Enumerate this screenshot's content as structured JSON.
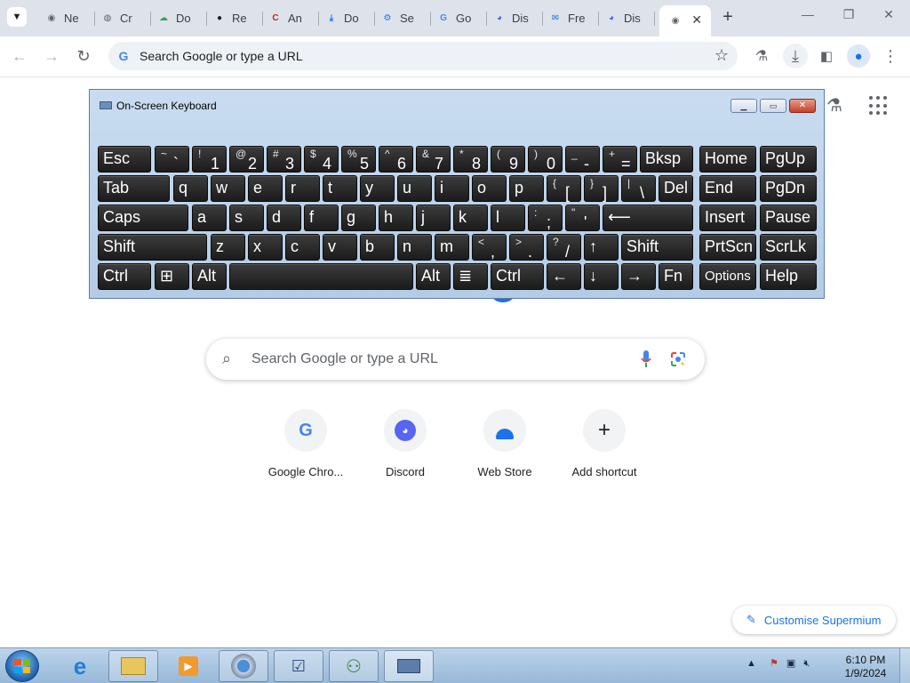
{
  "browser": {
    "tabs": [
      {
        "label": "Ne",
        "icon": "chrome-icon",
        "color": "#5f6368"
      },
      {
        "label": "Cr",
        "icon": "globe-icon",
        "color": "#5f6368"
      },
      {
        "label": "Do",
        "icon": "cloud-icon",
        "color": "#34a853"
      },
      {
        "label": "Re",
        "icon": "github-icon",
        "color": "#1f1f1f"
      },
      {
        "label": "An",
        "icon": "anthropic-c-icon",
        "color": "#c5221f"
      },
      {
        "label": "Do",
        "icon": "download-icon",
        "color": "#1a73e8"
      },
      {
        "label": "Se",
        "icon": "settings-icon",
        "color": "#1a73e8"
      },
      {
        "label": "Go",
        "icon": "google-icon",
        "color": "#4285f4"
      },
      {
        "label": "Dis",
        "icon": "discord-icon",
        "color": "#5865f2"
      },
      {
        "label": "Fre",
        "icon": "sms-icon",
        "color": "#1a73e8"
      },
      {
        "label": "Dis",
        "icon": "discord-icon",
        "color": "#5865f2"
      }
    ],
    "active_tab_icon": "chrome-icon",
    "new_tab_symbol": "+",
    "omnibox_placeholder": "Search Google or type a URL"
  },
  "ntp": {
    "search_placeholder": "Search Google or type a URL",
    "shortcuts": [
      {
        "label": "Google Chro...",
        "icon": "google-icon"
      },
      {
        "label": "Discord",
        "icon": "discord-icon"
      },
      {
        "label": "Web Store",
        "icon": "webstore-icon"
      },
      {
        "label": "Add shortcut",
        "icon": "plus-icon"
      }
    ],
    "customise_label": "Customise Supermium"
  },
  "osk": {
    "title": "On-Screen Keyboard",
    "rows": [
      [
        {
          "main": "Esc"
        },
        {
          "sub": "~",
          "low": "`"
        },
        {
          "sub": "!",
          "low": "1"
        },
        {
          "sub": "@",
          "low": "2"
        },
        {
          "sub": "#",
          "low": "3"
        },
        {
          "sub": "$",
          "low": "4"
        },
        {
          "sub": "%",
          "low": "5"
        },
        {
          "sub": "^",
          "low": "6"
        },
        {
          "sub": "&",
          "low": "7"
        },
        {
          "sub": "*",
          "low": "8"
        },
        {
          "sub": "(",
          "low": "9"
        },
        {
          "sub": ")",
          "low": "0"
        },
        {
          "sub": "_",
          "low": "-"
        },
        {
          "sub": "+",
          "low": "="
        },
        {
          "main": "Bksp"
        },
        {
          "main": "Home"
        },
        {
          "main": "PgUp"
        }
      ],
      [
        {
          "main": "Tab"
        },
        {
          "main": "q"
        },
        {
          "main": "w"
        },
        {
          "main": "e"
        },
        {
          "main": "r"
        },
        {
          "main": "t"
        },
        {
          "main": "y"
        },
        {
          "main": "u"
        },
        {
          "main": "i"
        },
        {
          "main": "o"
        },
        {
          "main": "p"
        },
        {
          "sub": "{",
          "low": "["
        },
        {
          "sub": "}",
          "low": "]"
        },
        {
          "sub": "|",
          "low": "\\"
        },
        {
          "main": "Del"
        },
        {
          "main": "End"
        },
        {
          "main": "PgDn"
        }
      ],
      [
        {
          "main": "Caps"
        },
        {
          "main": "a"
        },
        {
          "main": "s"
        },
        {
          "main": "d"
        },
        {
          "main": "f"
        },
        {
          "main": "g"
        },
        {
          "main": "h"
        },
        {
          "main": "j"
        },
        {
          "main": "k"
        },
        {
          "main": "l"
        },
        {
          "sub": ":",
          "low": ";"
        },
        {
          "sub": "\"",
          "low": "'"
        },
        {
          "main": "⟵"
        },
        {
          "main": "Insert"
        },
        {
          "main": "Pause"
        }
      ],
      [
        {
          "main": "Shift"
        },
        {
          "main": "z"
        },
        {
          "main": "x"
        },
        {
          "main": "c"
        },
        {
          "main": "v"
        },
        {
          "main": "b"
        },
        {
          "main": "n"
        },
        {
          "main": "m"
        },
        {
          "sub": "<",
          "low": ","
        },
        {
          "sub": ">",
          "low": "."
        },
        {
          "sub": "?",
          "low": "/"
        },
        {
          "main": "↑"
        },
        {
          "main": "Shift"
        },
        {
          "main": "PrtScn"
        },
        {
          "main": "ScrLk"
        }
      ],
      [
        {
          "main": "Ctrl"
        },
        {
          "main": "⊞"
        },
        {
          "main": "Alt"
        },
        {
          "main": ""
        },
        {
          "main": "Alt"
        },
        {
          "main": "≣"
        },
        {
          "main": "Ctrl"
        },
        {
          "main": "←"
        },
        {
          "main": "↓"
        },
        {
          "main": "→"
        },
        {
          "main": "Fn"
        },
        {
          "main": "Options"
        },
        {
          "main": "Help"
        }
      ]
    ]
  },
  "taskbar": {
    "apps": [
      "internet-explorer-icon",
      "file-explorer-icon",
      "media-player-icon",
      "chrome-icon",
      "app-icon",
      "people-icon",
      "osk-icon"
    ],
    "time": "6:10 PM",
    "date": "1/9/2024"
  }
}
